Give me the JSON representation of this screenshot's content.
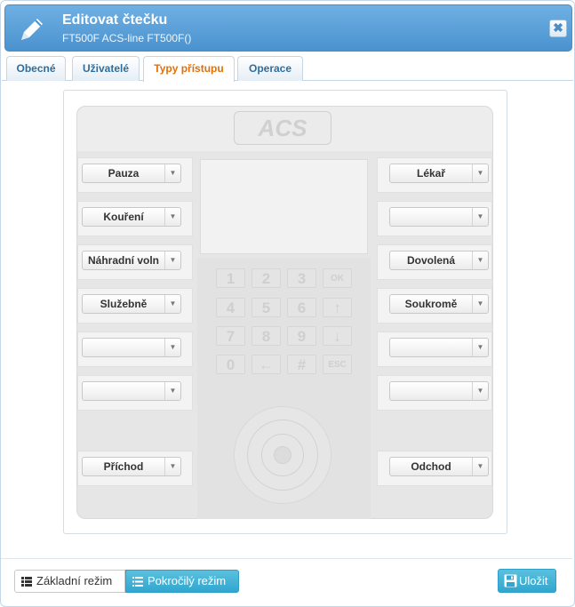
{
  "dialog": {
    "title": "Editovat čtečku",
    "subtitle": "FT500F ACS-line FT500F()",
    "close_label": "✖"
  },
  "tabs": [
    {
      "label": "Obecné",
      "active": false
    },
    {
      "label": "Uživatelé",
      "active": false
    },
    {
      "label": "Typy přístupu",
      "active": true
    },
    {
      "label": "Operace",
      "active": false
    }
  ],
  "device": {
    "logo_text": "ACS",
    "keys": [
      "1",
      "2",
      "3",
      "OK",
      "4",
      "5",
      "6",
      "↑",
      "7",
      "8",
      "9",
      "↓",
      "0",
      "←",
      "#",
      "ESC"
    ]
  },
  "left_buttons": [
    "Pauza",
    "Kouření",
    "Náhradní voln",
    "Služebně",
    "",
    "",
    "Příchod"
  ],
  "right_buttons": [
    "Lékař",
    "",
    "Dovolená",
    "Soukromě",
    "",
    "",
    "Odchod"
  ],
  "footer": {
    "basic_mode_label": "Základní režim",
    "advanced_mode_label": "Pokročilý režim",
    "save_label": "Uložit"
  },
  "colors": {
    "header_blue": "#4a92cf",
    "active_tab": "#e17009",
    "info_button": "#31a6cf"
  }
}
